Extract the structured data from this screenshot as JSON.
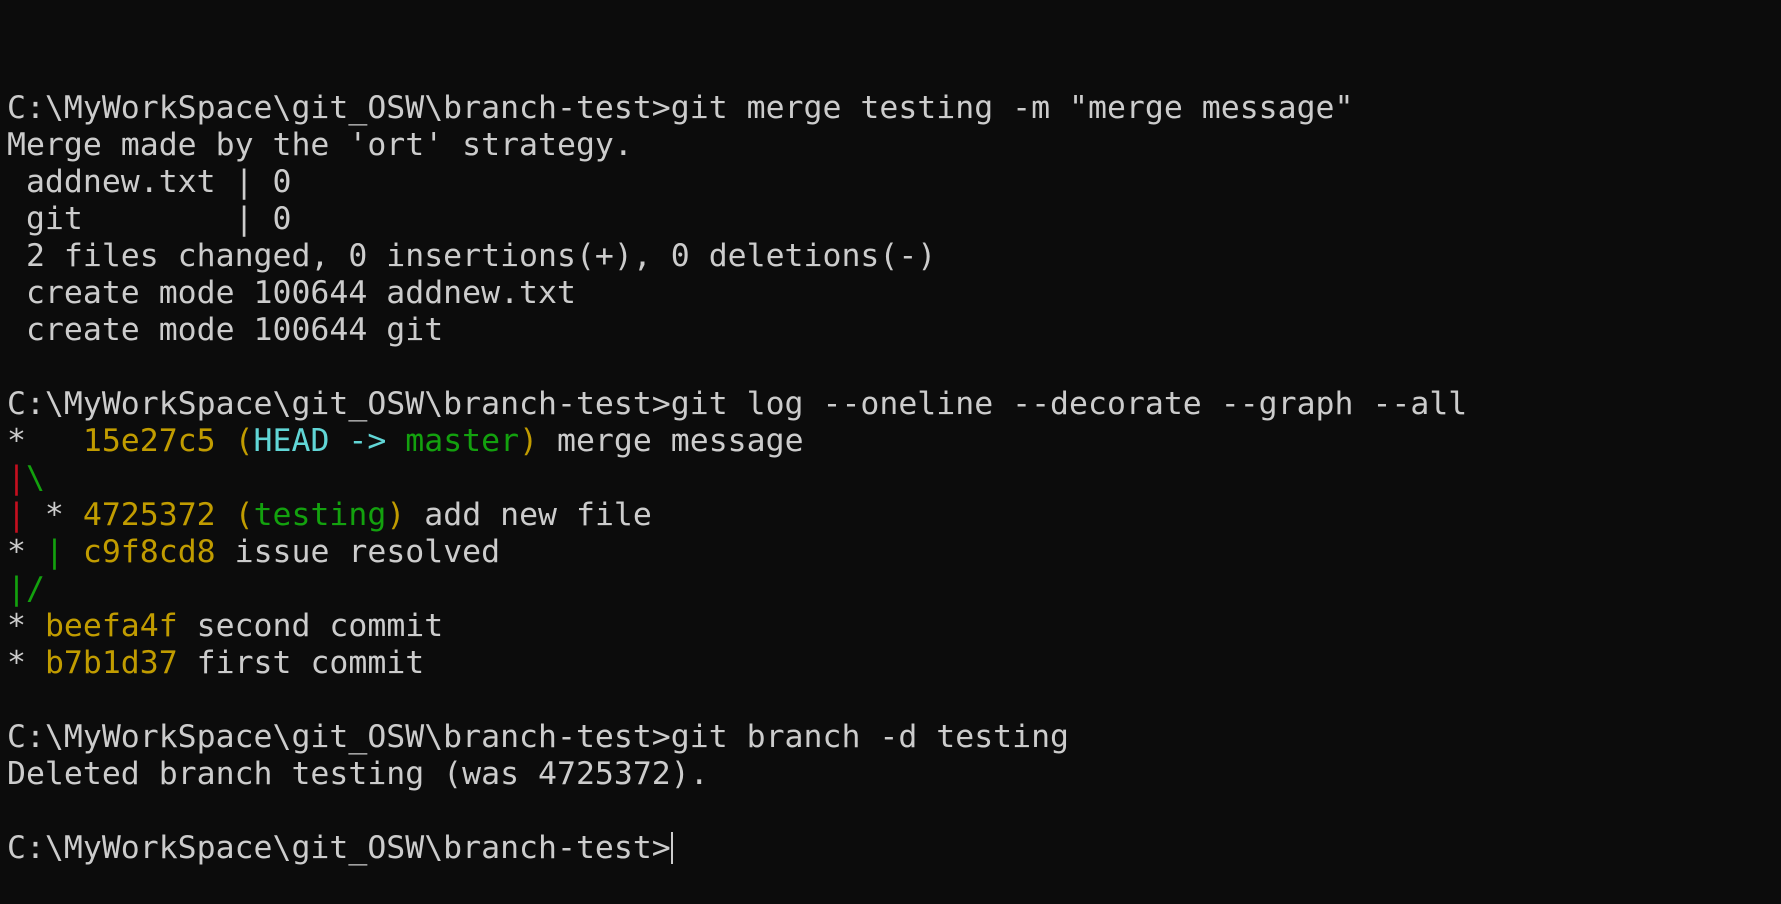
{
  "colors": {
    "background": "#0c0c0c",
    "default_text": "#cccccc",
    "hash": "#c19c00",
    "head": "#61d6d6",
    "branch": "#13a10e",
    "graph_red": "#c50f1f",
    "graph_green": "#13a10e"
  },
  "terminal": {
    "lines": [
      [
        {
          "text": "C:\\MyWorkSpace\\git_OSW\\branch-test>git merge testing -m \"merge message\"",
          "color": "#cccccc"
        }
      ],
      [
        {
          "text": "Merge made by the 'ort' strategy.",
          "color": "#cccccc"
        }
      ],
      [
        {
          "text": " addnew.txt | 0",
          "color": "#cccccc"
        }
      ],
      [
        {
          "text": " git        | 0",
          "color": "#cccccc"
        }
      ],
      [
        {
          "text": " 2 files changed, 0 insertions(+), 0 deletions(-)",
          "color": "#cccccc"
        }
      ],
      [
        {
          "text": " create mode 100644 addnew.txt",
          "color": "#cccccc"
        }
      ],
      [
        {
          "text": " create mode 100644 git",
          "color": "#cccccc"
        }
      ],
      [],
      [
        {
          "text": "C:\\MyWorkSpace\\git_OSW\\branch-test>git log --oneline --decorate --graph --all",
          "color": "#cccccc"
        }
      ],
      [
        {
          "text": "*   ",
          "color": "#cccccc"
        },
        {
          "text": "15e27c5 (",
          "color": "#c19c00"
        },
        {
          "text": "HEAD -> ",
          "color": "#61d6d6"
        },
        {
          "text": "master",
          "color": "#13a10e"
        },
        {
          "text": ")",
          "color": "#c19c00"
        },
        {
          "text": " merge message",
          "color": "#cccccc"
        }
      ],
      [
        {
          "text": "|",
          "color": "#c50f1f"
        },
        {
          "text": "\\",
          "color": "#13a10e"
        }
      ],
      [
        {
          "text": "|",
          "color": "#c50f1f"
        },
        {
          "text": " * ",
          "color": "#cccccc"
        },
        {
          "text": "4725372 (",
          "color": "#c19c00"
        },
        {
          "text": "testing",
          "color": "#13a10e"
        },
        {
          "text": ")",
          "color": "#c19c00"
        },
        {
          "text": " add new file",
          "color": "#cccccc"
        }
      ],
      [
        {
          "text": "* ",
          "color": "#cccccc"
        },
        {
          "text": "|",
          "color": "#13a10e"
        },
        {
          "text": " ",
          "color": "#cccccc"
        },
        {
          "text": "c9f8cd8",
          "color": "#c19c00"
        },
        {
          "text": " issue resolved",
          "color": "#cccccc"
        }
      ],
      [
        {
          "text": "|/",
          "color": "#13a10e"
        }
      ],
      [
        {
          "text": "* ",
          "color": "#cccccc"
        },
        {
          "text": "beefa4f",
          "color": "#c19c00"
        },
        {
          "text": " second commit",
          "color": "#cccccc"
        }
      ],
      [
        {
          "text": "* ",
          "color": "#cccccc"
        },
        {
          "text": "b7b1d37",
          "color": "#c19c00"
        },
        {
          "text": " first commit",
          "color": "#cccccc"
        }
      ],
      [],
      [
        {
          "text": "C:\\MyWorkSpace\\git_OSW\\branch-test>git branch -d testing",
          "color": "#cccccc"
        }
      ],
      [
        {
          "text": "Deleted branch testing (was 4725372).",
          "color": "#cccccc"
        }
      ],
      [],
      [
        {
          "text": "C:\\MyWorkSpace\\git_OSW\\branch-test>",
          "color": "#cccccc"
        }
      ]
    ],
    "cursor_line": 20
  }
}
